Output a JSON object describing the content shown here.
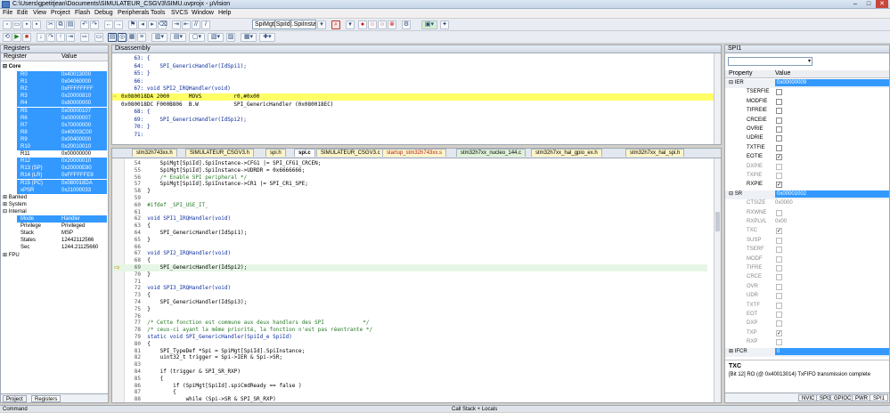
{
  "window": {
    "title": "C:\\Users\\gpetitjean\\Documents\\SIMULATEUR_CSGV3\\SIMU.uvprojx - µVision"
  },
  "menu": [
    "File",
    "Edit",
    "View",
    "Project",
    "Flash",
    "Debug",
    "Peripherals",
    "Tools",
    "SVCS",
    "Window",
    "Help"
  ],
  "toolbar": {
    "function_select": "SpiMgt[SpiId].SpiInstanc"
  },
  "registers": {
    "title": "Registers",
    "col_register": "Register",
    "col_value": "Value",
    "core_label": "Core",
    "rows": [
      {
        "name": "R0",
        "value": "0x40013000"
      },
      {
        "name": "R1",
        "value": "0x04060000"
      },
      {
        "name": "R2",
        "value": "0xFFFFFFFF"
      },
      {
        "name": "R3",
        "value": "0x20000810"
      },
      {
        "name": "R4",
        "value": "0x80000000"
      },
      {
        "name": "R5",
        "value": "0x00000107"
      },
      {
        "name": "R6",
        "value": "0x00000007"
      },
      {
        "name": "R7",
        "value": "0x70000000"
      },
      {
        "name": "R8",
        "value": "0x40003C00"
      },
      {
        "name": "R9",
        "value": "0x00400000"
      },
      {
        "name": "R10",
        "value": "0x20010010"
      },
      {
        "name": "R11",
        "value": "0x00000000"
      },
      {
        "name": "R12",
        "value": "0x20000010"
      },
      {
        "name": "R13 (SP)",
        "value": "0x20000E80"
      },
      {
        "name": "R14 (LR)",
        "value": "0xFFFFFFE9"
      },
      {
        "name": "R15 (PC)",
        "value": "0x080018DA"
      },
      {
        "name": "xPSR",
        "value": "0x21000033"
      }
    ],
    "groups": [
      "Banked",
      "System",
      "Internal"
    ],
    "internal_rows": [
      {
        "name": "Mode",
        "value": "Handler"
      },
      {
        "name": "Privilege",
        "value": "Privileged"
      },
      {
        "name": "Stack",
        "value": "MSP"
      },
      {
        "name": "States",
        "value": "12442112566"
      },
      {
        "name": "Sec",
        "value": "1244.21125660"
      }
    ],
    "fpu_label": "FPU",
    "tab_project": "Project",
    "tab_registers": "Registers"
  },
  "disassembly": {
    "title": "Disassembly",
    "lines": [
      "    63: {",
      "    64:     SPI_GenericHandler(IdSpi1);",
      "    65: }",
      "    66: ",
      "    67: void SPI2_IRQHandler(void)",
      "0x080018DA 2000      MOVS          r0,#0x00",
      "0x080018DC F000B806  B.W           SPI_GenericHandler (0x080018EC)",
      "    68: {",
      "    69:     SPI_GenericHandler(IdSpi2);",
      "    70: }",
      "    71: "
    ],
    "current_index": 5
  },
  "editor": {
    "tabs": [
      "stm32h743xx.h",
      "SIMULATEUR_CSGV3.h",
      "spi.h",
      "spi.c",
      "SIMULATEUR_CSGV3.c",
      "startup_stm32h743xx.s",
      "stm32h7xx_nucleo_144.c",
      "stm32h7xx_hal_gpio_ex.h",
      "stm32h7xx_hal_spi.h"
    ],
    "active_tab": "spi.c",
    "lines": [
      {
        "n": "54",
        "t": "    SpiMgt[SpiId].SpiInstance->CFG1 |= SPI_CFG1_CRCEN;"
      },
      {
        "n": "55",
        "t": "    SpiMgt[SpiId].SpiInstance->UDRDR = 0x6666666;"
      },
      {
        "n": "56",
        "t": "    /* Enable SPI peripheral */"
      },
      {
        "n": "57",
        "t": "    SpiMgt[SpiId].SpiInstance->CR1 |= SPI_CR1_SPE;"
      },
      {
        "n": "58",
        "t": "}"
      },
      {
        "n": "59",
        "t": ""
      },
      {
        "n": "60",
        "t": "#ifdef _SPI_USE_IT_"
      },
      {
        "n": "61",
        "t": ""
      },
      {
        "n": "62",
        "t": "void SPI1_IRQHandler(void)"
      },
      {
        "n": "63",
        "t": "{"
      },
      {
        "n": "64",
        "t": "    SPI_GenericHandler(IdSpi1);"
      },
      {
        "n": "65",
        "t": "}"
      },
      {
        "n": "66",
        "t": ""
      },
      {
        "n": "67",
        "t": "void SPI2_IRQHandler(void)"
      },
      {
        "n": "68",
        "t": "{"
      },
      {
        "n": "69",
        "t": "    SPI_GenericHandler(IdSpi2);"
      },
      {
        "n": "70",
        "t": "}"
      },
      {
        "n": "71",
        "t": ""
      },
      {
        "n": "72",
        "t": "void SPI3_IRQHandler(void)"
      },
      {
        "n": "73",
        "t": "{"
      },
      {
        "n": "74",
        "t": "    SPI_GenericHandler(IdSpi3);"
      },
      {
        "n": "75",
        "t": "}"
      },
      {
        "n": "76",
        "t": ""
      },
      {
        "n": "77",
        "t": "/* Cette fonction est commune aux deux handlers des SPI            */"
      },
      {
        "n": "78",
        "t": "/* ceux-ci ayant la même priorité, la fonction n'est pas réentrante */"
      },
      {
        "n": "79",
        "t": "static void SPI_GenericHandler(SpiId_e SpiId)"
      },
      {
        "n": "80",
        "t": "{"
      },
      {
        "n": "81",
        "t": "    SPI_TypeDef *Spi = SpiMgt[SpiId].SpiInstance;"
      },
      {
        "n": "82",
        "t": "    uint32_t trigger = Spi->IER & Spi->SR;"
      },
      {
        "n": "83",
        "t": ""
      },
      {
        "n": "84",
        "t": "    if (trigger & SPI_SR_RXP)"
      },
      {
        "n": "85",
        "t": "    {"
      },
      {
        "n": "86",
        "t": "        if (SpiMgt[SpiId].spiCmdReady == false )"
      },
      {
        "n": "87",
        "t": "        {"
      },
      {
        "n": "88",
        "t": "            while (Spi->SR & SPI_SR_RXP)"
      }
    ],
    "current_line": "69"
  },
  "spi": {
    "title": "SPI1",
    "col_property": "Property",
    "col_value": "Value",
    "rows": [
      {
        "name": "IER",
        "value": "0x00000009",
        "group": true
      },
      {
        "name": "TSERFIE",
        "check": false
      },
      {
        "name": "MODFIE",
        "check": false
      },
      {
        "name": "TIFREIE",
        "check": false
      },
      {
        "name": "CRCEIE",
        "check": false
      },
      {
        "name": "OVRIE",
        "check": false
      },
      {
        "name": "UDRIE",
        "check": false
      },
      {
        "name": "TXTFIE",
        "check": false
      },
      {
        "name": "EOTIE",
        "check": true
      },
      {
        "name": "DXPIE",
        "check": false,
        "dim": true
      },
      {
        "name": "TXPIE",
        "check": false,
        "dim": true
      },
      {
        "name": "RXPIE",
        "check": true
      },
      {
        "name": "SR",
        "value": "0x00001002",
        "group": true
      },
      {
        "name": "CTSIZE",
        "value": "0x0000",
        "dim": true
      },
      {
        "name": "RXWNE",
        "check": false,
        "dim": true
      },
      {
        "name": "RXPLVL",
        "value": "0x00",
        "dim": true
      },
      {
        "name": "TXC",
        "check": true,
        "dim": true
      },
      {
        "name": "SUSP",
        "check": false,
        "dim": true
      },
      {
        "name": "TSERF",
        "check": false,
        "dim": true
      },
      {
        "name": "MODF",
        "check": false,
        "dim": true
      },
      {
        "name": "TIFRE",
        "check": false,
        "dim": true
      },
      {
        "name": "CRCE",
        "check": false,
        "dim": true
      },
      {
        "name": "OVR",
        "check": false,
        "dim": true
      },
      {
        "name": "UDR",
        "check": false,
        "dim": true
      },
      {
        "name": "TXTF",
        "check": false,
        "dim": true
      },
      {
        "name": "EOT",
        "check": false,
        "dim": true
      },
      {
        "name": "DXP",
        "check": false,
        "dim": true
      },
      {
        "name": "TXP",
        "check": true,
        "dim": true
      },
      {
        "name": "RXP",
        "check": false,
        "dim": true
      },
      {
        "name": "IFCR",
        "value": "0",
        "group": true
      }
    ],
    "info_title": "TXC",
    "info_desc": "[Bit 12] RO (@ 0x40013014) TxFIFO transmission  complete",
    "bottom_tabs": [
      "NVIC",
      "SPI3",
      "GPIOC",
      "PWR",
      "SPI1"
    ]
  },
  "status": {
    "command_label": "Command",
    "callstack_label": "Call Stack + Locals"
  }
}
